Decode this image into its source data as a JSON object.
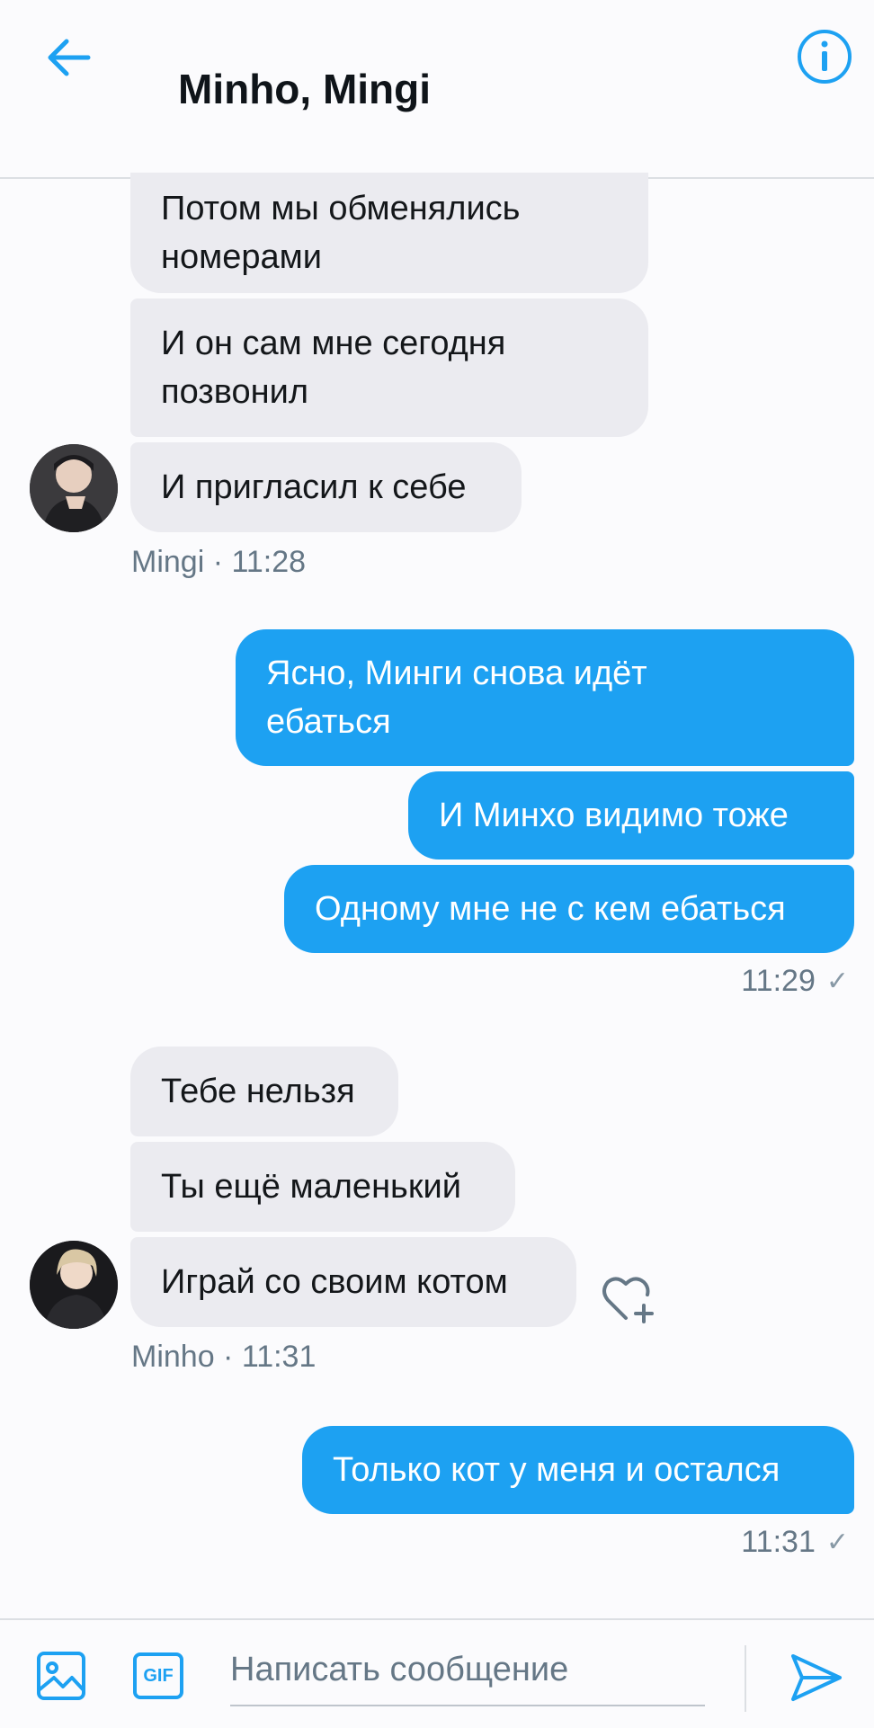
{
  "header": {
    "title": "Minho, Mingi",
    "back_icon": "arrow-left-icon",
    "info_icon": "info-icon",
    "accent": "#1da1f2"
  },
  "messages": [
    {
      "from": "Mingi",
      "text_lines": [
        "Потом мы обменялись",
        "номерами"
      ]
    },
    {
      "from": "Mingi",
      "text_lines": [
        "И он сам мне сегодня",
        "позвонил"
      ]
    },
    {
      "from": "Mingi",
      "text_lines": [
        "И пригласил к себе"
      ]
    },
    {
      "from": "me",
      "text_lines": [
        "Ясно, Минги снова идёт",
        "ебаться"
      ]
    },
    {
      "from": "me",
      "text_lines": [
        "И Минхо видимо тоже"
      ]
    },
    {
      "from": "me",
      "text_lines": [
        "Одному мне не с кем ебаться"
      ]
    },
    {
      "from": "Minho",
      "text_lines": [
        "Тебе нельзя"
      ]
    },
    {
      "from": "Minho",
      "text_lines": [
        "Ты ещё маленький"
      ]
    },
    {
      "from": "Minho",
      "text_lines": [
        "Играй со своим котом"
      ]
    },
    {
      "from": "me",
      "text_lines": [
        "Только кот у меня и остался"
      ]
    }
  ],
  "meta": {
    "mingi": "Mingi · 11:28",
    "me_1": "11:29",
    "minho": "Minho · 11:31",
    "me_2": "11:31",
    "check": "✓"
  },
  "composer": {
    "placeholder": "Написать сообщение",
    "gif_label": "GIF",
    "image_icon": "image-icon",
    "send_icon": "send-icon"
  }
}
